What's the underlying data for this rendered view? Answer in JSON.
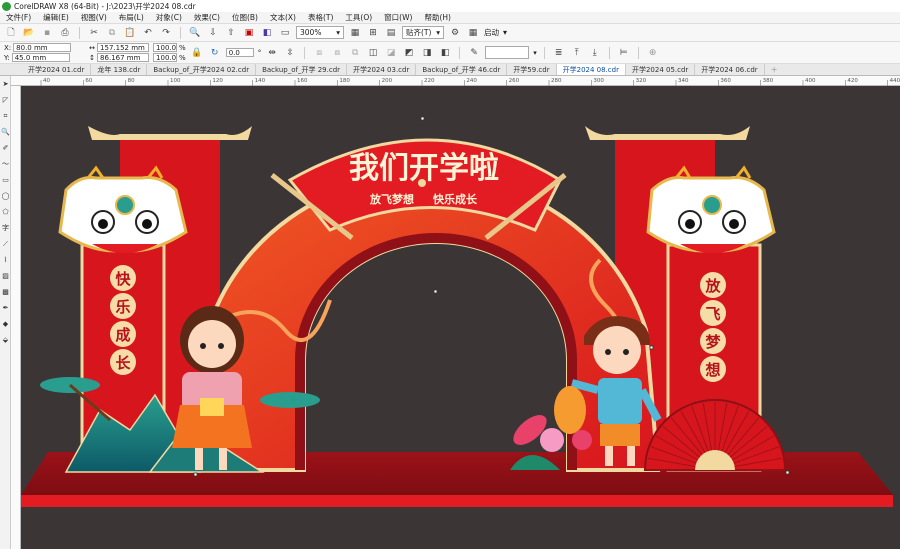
{
  "window": {
    "title": "CorelDRAW X8 (64-Bit) - J:\\2023\\开学2024 08.cdr"
  },
  "menu": [
    "文件(F)",
    "编辑(E)",
    "视图(V)",
    "布局(L)",
    "对象(C)",
    "效果(C)",
    "位图(B)",
    "文本(X)",
    "表格(T)",
    "工具(O)",
    "窗口(W)",
    "帮助(H)"
  ],
  "toolbar": {
    "zoom": "300%",
    "snap_label": "贴齐(T)",
    "launch_label": "启动"
  },
  "propbar": {
    "x": "80.0 mm",
    "y": "45.0 mm",
    "width": "157.152 mm",
    "height": "86.167 mm",
    "scale_x": "100.0",
    "scale_y": "100.0",
    "scale_unit": "%",
    "rotation": "0.0",
    "rotation_unit": "°"
  },
  "tabs": [
    "开学2024 01.cdr",
    "龙年 138.cdr",
    "Backup_of_开学2024 02.cdr",
    "Backup_of_开学 29.cdr",
    "开学2024 03.cdr",
    "Backup_of_开学 46.cdr",
    "开学59.cdr",
    "开学2024 08.cdr",
    "开学2024 05.cdr",
    "开学2024 06.cdr"
  ],
  "active_tab": 7,
  "ruler_ticks": [
    "40",
    "60",
    "80",
    "100",
    "120",
    "140",
    "160",
    "180",
    "200",
    "220",
    "240",
    "260",
    "280",
    "300",
    "320",
    "340",
    "360",
    "380",
    "400",
    "420",
    "440"
  ],
  "design": {
    "banner_title": "我们开学啦",
    "banner_sub_left": "放飞梦想",
    "banner_sub_right": "快乐成长",
    "left_pillar": [
      "快",
      "乐",
      "成",
      "长"
    ],
    "right_pillar": [
      "放",
      "飞",
      "梦",
      "想"
    ]
  },
  "colors": {
    "canvas": "#3b3536",
    "red": "#d7151d",
    "dark_red": "#8f1016",
    "gold": "#f2d9a0"
  }
}
